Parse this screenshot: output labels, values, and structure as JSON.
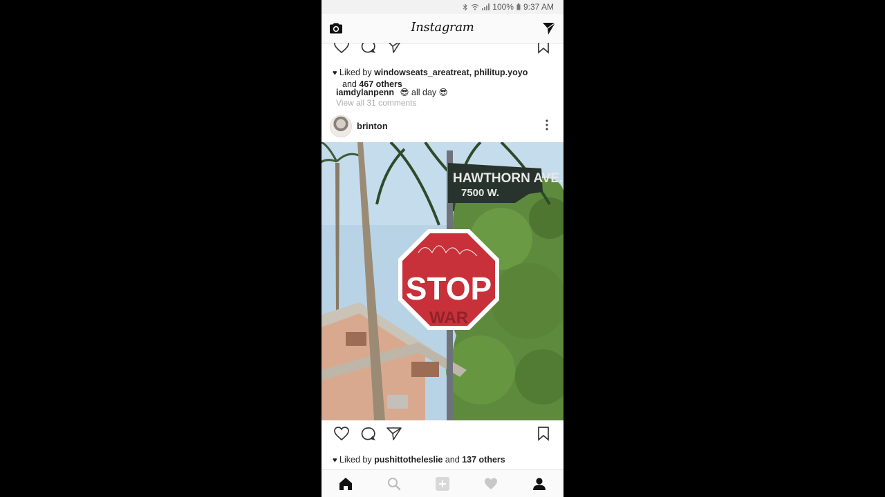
{
  "status_bar": {
    "battery": "100%",
    "time": "9:37 AM"
  },
  "header": {
    "title": "Instagram",
    "left_icon": "camera-icon",
    "right_icon": "direct-message-icon"
  },
  "post1": {
    "liked_by_prefix": "Liked by",
    "liked_by_users": "windowseats_areatreat, philitup.yoyo",
    "and_text": "and",
    "others": "467 others",
    "caption_user": "iamdylanpenn",
    "caption_text": "😎 all day 😎",
    "view_comments": "View all 31 comments"
  },
  "post2": {
    "username": "brinton",
    "image": {
      "street_sign_name": "HAWTHORN AVE.",
      "street_sign_block": "7500 W.",
      "stop_text": "STOP",
      "stop_graffiti": "WAR"
    },
    "liked_by_prefix": "Liked by",
    "liked_by_users": "pushittotheleslie",
    "and_text": "and",
    "others": "137 others"
  },
  "bottom_nav": [
    "home-icon",
    "search-icon",
    "add-post-icon",
    "activity-heart-icon",
    "profile-icon"
  ],
  "colors": {
    "stop_red": "#c8313a",
    "sign_green": "#27332c",
    "sky": "#b8d3e6",
    "foliage": "#5e8a3e"
  }
}
